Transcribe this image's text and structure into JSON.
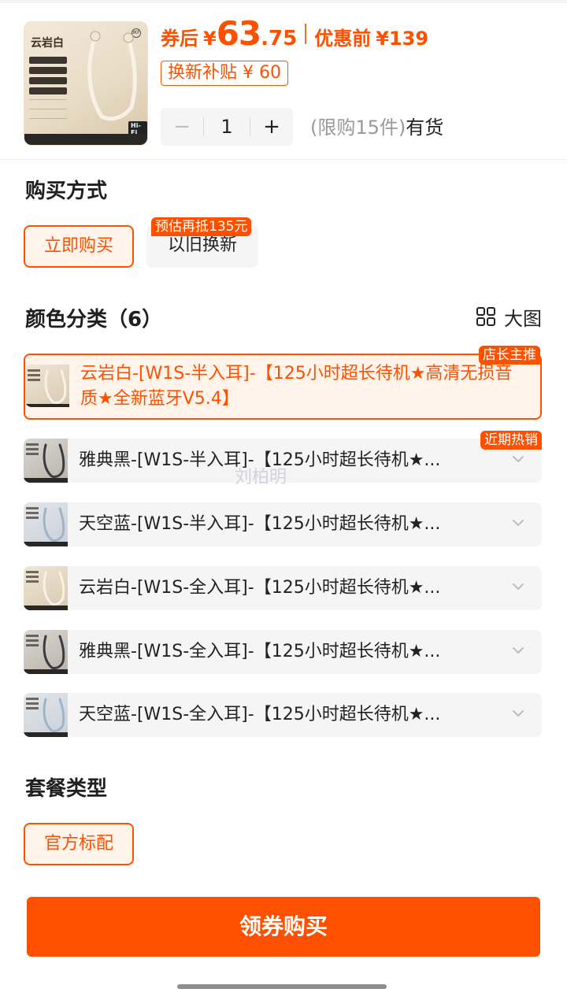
{
  "product": {
    "thumb_title": "云岩白",
    "thumb_hifi": "Hi-Fi",
    "price_after_label": "券后",
    "currency": "¥",
    "price_int": "63",
    "price_dec": ".75",
    "price_before_label": "优惠前",
    "price_before": "¥139",
    "subsidy_tag": "换新补贴 ¥ 60",
    "quantity": "1",
    "minus_symbol": "−",
    "plus_symbol": "+",
    "stock_limit": "(限购15件)",
    "stock_status": "有货"
  },
  "purchase_method": {
    "title": "购买方式",
    "options": [
      {
        "label": "立即购买",
        "selected": true
      },
      {
        "label": "以旧换新",
        "selected": false,
        "tag": "预估再抵135元"
      }
    ]
  },
  "color": {
    "title": "颜色分类（6）",
    "bigview_label": "大图",
    "items": [
      {
        "label": "云岩白-[W1S-半入耳]-【125小时超长待机★高清无损音质★全新蓝牙V5.4】",
        "selected": true,
        "tag": "店长主推",
        "tone": "white"
      },
      {
        "label": "雅典黑-[W1S-半入耳]-【125小时超长待机★...",
        "selected": false,
        "tag": "近期热销",
        "tone": "black"
      },
      {
        "label": "天空蓝-[W1S-半入耳]-【125小时超长待机★...",
        "selected": false,
        "tone": "blue"
      },
      {
        "label": "云岩白-[W1S-全入耳]-【125小时超长待机★...",
        "selected": false,
        "tone": "white"
      },
      {
        "label": "雅典黑-[W1S-全入耳]-【125小时超长待机★...",
        "selected": false,
        "tone": "black"
      },
      {
        "label": "天空蓝-[W1S-全入耳]-【125小时超长待机★...",
        "selected": false,
        "tone": "blue"
      }
    ]
  },
  "watermark": "刘柏明",
  "package": {
    "title": "套餐类型",
    "options": [
      {
        "label": "官方标配",
        "selected": true
      }
    ]
  },
  "buy_button": "领券购买",
  "colors": {
    "accent": "#ff5000",
    "accent_bg": "#fff3ea",
    "chip_bg": "#f5f5f5"
  }
}
